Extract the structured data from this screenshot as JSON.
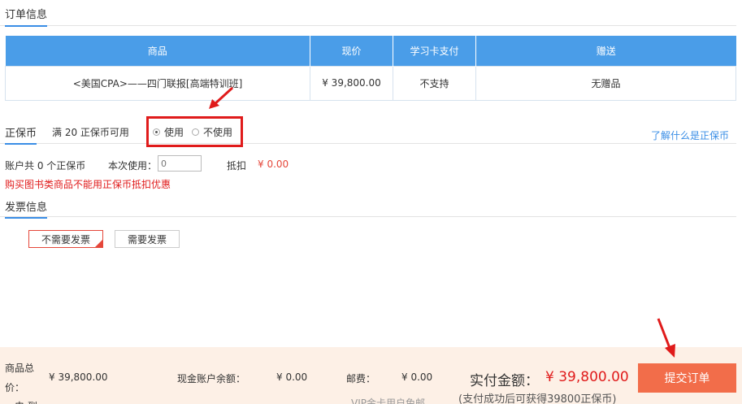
{
  "order": {
    "title": "订单信息",
    "headers": [
      "商品",
      "现价",
      "学习卡支付",
      "赠送"
    ],
    "rows": [
      {
        "product": "<美国CPA>——四门联报[高端特训班]",
        "price": "¥ 39,800.00",
        "card_pay": "不支持",
        "gift": "无赠品"
      }
    ]
  },
  "coin": {
    "title": "正保币",
    "available": "满 20 正保币可用",
    "use_label": "使用",
    "no_use_label": "不使用",
    "selected": "使用",
    "learn_link": "了解什么是正保币",
    "account_text": "账户共 0 个正保币",
    "this_use_label": "本次使用：",
    "this_use_value": "0",
    "deduct_label": "抵扣",
    "deduct_value": "¥ 0.00",
    "book_warning": "购买图书类商品不能用正保币抵扣优惠"
  },
  "invoice": {
    "title": "发票信息",
    "no_invoice": "不需要发票",
    "need_invoice": "需要发票",
    "selected": "不需要发票"
  },
  "footer": {
    "goods_total_label": "商品总价：",
    "goods_total_value": "¥ 39,800.00",
    "cash_label": "现金账户余额：",
    "cash_value": "¥ 0.00",
    "postage_label": "邮费：",
    "postage_value": "¥ 0.00",
    "vip_note": "VIP金卡用户免邮",
    "left_cut": "电 到",
    "pay_label": "实付金额：",
    "pay_value": "¥ 39,800.00",
    "pay_note": "(支付成功后可获得39800正保币)",
    "submit_label": "提交订单"
  },
  "colors": {
    "accent_blue": "#4a9de8",
    "price_red": "#e01b1b",
    "submit_orange": "#f26d4a",
    "footer_bg": "#fdf0e6"
  }
}
